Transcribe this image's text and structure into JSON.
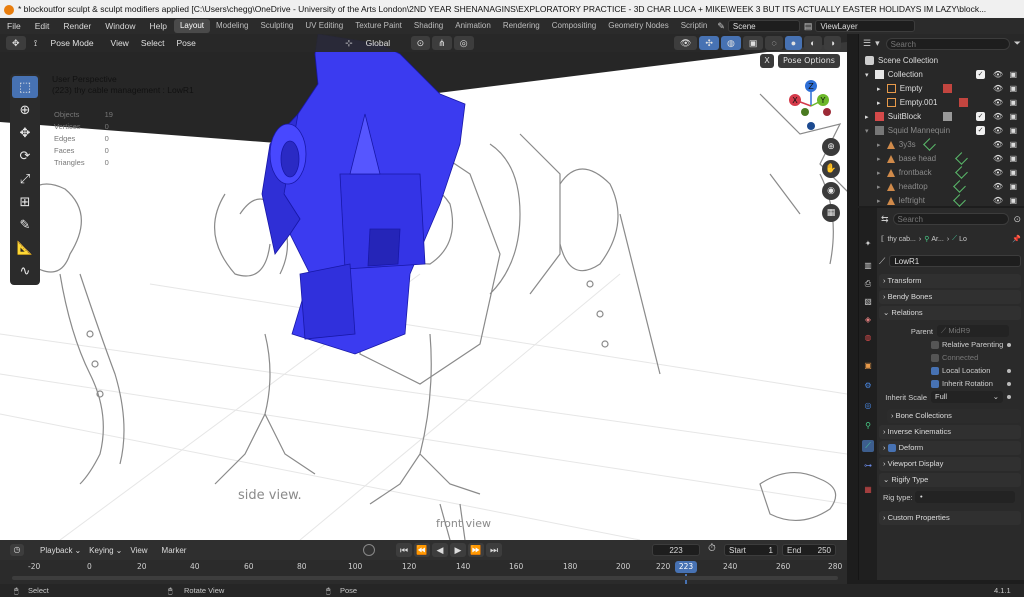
{
  "window": {
    "title": "* blockoutfor sculpt & sculpt modifiers applied [C:\\Users\\chegg\\OneDrive - University of the Arts London\\2ND YEAR SHENANAGINS\\EXPLORATORY PRACTICE - 3D CHAR LUCA + MIKE\\WEEK 3 BUT ITS ACTUALLY EASTER HOLIDAYS IM LAZY\\block..."
  },
  "menubar": {
    "menus": [
      "File",
      "Edit",
      "Render",
      "Window",
      "Help"
    ],
    "workspaces": [
      "Layout",
      "Modeling",
      "Sculpting",
      "UV Editing",
      "Texture Paint",
      "Shading",
      "Animation",
      "Rendering",
      "Compositing",
      "Geometry Nodes",
      "Scriptin"
    ],
    "active_workspace": "Layout",
    "scene": "Scene",
    "view_layer": "ViewLayer"
  },
  "viewport": {
    "mode": "Pose Mode",
    "menus": [
      "View",
      "Select",
      "Pose"
    ],
    "orientation": "Global",
    "pose_options": "Pose Options",
    "close_label": "X",
    "perspective": "User Perspective",
    "active_info": "(223) thy cable management : LowR1",
    "stats": [
      {
        "label": "Objects",
        "value": "19"
      },
      {
        "label": "Vertices",
        "value": "0"
      },
      {
        "label": "Edges",
        "value": "0"
      },
      {
        "label": "Faces",
        "value": "0"
      },
      {
        "label": "Triangles",
        "value": "0"
      }
    ],
    "gizmo": {
      "x": "X",
      "y": "Y",
      "z": "Z"
    },
    "sketch_text_1": "side view.",
    "sketch_text_2": "front view",
    "colors": {
      "blockout": "#3b3bf0",
      "sketch": "#8c8c8c"
    }
  },
  "outliner": {
    "search_placeholder": "Search",
    "root": "Scene Collection",
    "items": [
      {
        "label": "Collection",
        "dim": false
      },
      {
        "label": "Empty",
        "dim": false
      },
      {
        "label": "Empty.001",
        "dim": false
      },
      {
        "label": "SuitBlock",
        "dim": false
      },
      {
        "label": "Squid Mannequin",
        "dim": true
      },
      {
        "label": "3y3s",
        "dim": true
      },
      {
        "label": "base head",
        "dim": true
      },
      {
        "label": "frontback",
        "dim": true
      },
      {
        "label": "headtop",
        "dim": true
      },
      {
        "label": "leftright",
        "dim": true
      }
    ]
  },
  "properties": {
    "search_placeholder": "Search",
    "breadcrumb": [
      "thy cab...",
      "Ar...",
      "Lo"
    ],
    "bone_name": "LowR1",
    "panels": {
      "transform": "Transform",
      "bendy_bones": "Bendy Bones",
      "relations": "Relations",
      "parent_label": "Parent",
      "parent_value": "MidR9",
      "relative_parenting": "Relative Parenting",
      "connected": "Connected",
      "local_location": "Local Location",
      "inherit_rotation": "Inherit Rotation",
      "inherit_scale_label": "Inherit Scale",
      "inherit_scale_value": "Full",
      "bone_collections": "Bone Collections",
      "inverse_kinematics": "Inverse Kinematics",
      "deform": "Deform",
      "viewport_display": "Viewport Display",
      "rigify_type": "Rigify Type",
      "rig_type_label": "Rig type:",
      "custom_properties": "Custom Properties"
    }
  },
  "timeline": {
    "menus": [
      "Playback",
      "Keying",
      "View",
      "Marker"
    ],
    "current_frame": "223",
    "start_label": "Start",
    "start_value": "1",
    "end_label": "End",
    "end_value": "250",
    "ruler": [
      "-20",
      "0",
      "20",
      "40",
      "60",
      "80",
      "100",
      "120",
      "140",
      "160",
      "180",
      "200",
      "220",
      "240",
      "260",
      "280"
    ],
    "playhead_label": "223"
  },
  "statusbar": {
    "select": "Select",
    "rotate_view": "Rotate View",
    "pose": "Pose",
    "version": "4.1.1"
  }
}
